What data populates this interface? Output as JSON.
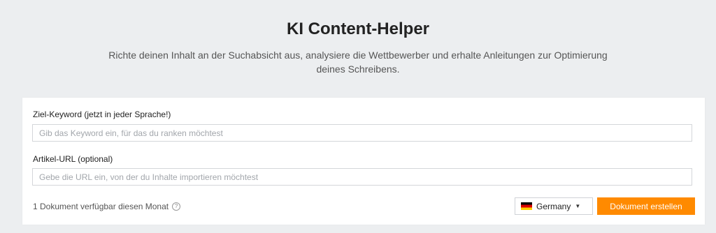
{
  "header": {
    "title": "KI Content-Helper",
    "subtitle": "Richte deinen Inhalt an der Suchabsicht aus, analysiere die Wettbewerber und erhalte Anleitungen zur Optimierung deines Schreibens."
  },
  "form": {
    "keyword": {
      "label": "Ziel-Keyword (jetzt in jeder Sprache!)",
      "value": "",
      "placeholder": "Gib das Keyword ein, für das du ranken möchtest"
    },
    "url": {
      "label": "Artikel-URL (optional)",
      "value": "",
      "placeholder": "Gebe die URL ein, von der du Inhalte importieren möchtest"
    },
    "footer": {
      "quota_text": "1 Dokument verfügbar diesen Monat",
      "help_icon": "question-circle-icon",
      "country": {
        "selected": "Germany",
        "flag_icon": "flag-germany-icon"
      },
      "create_label": "Dokument erstellen"
    }
  },
  "colors": {
    "background": "#eceef0",
    "card": "#ffffff",
    "accent": "#ff8a00"
  }
}
